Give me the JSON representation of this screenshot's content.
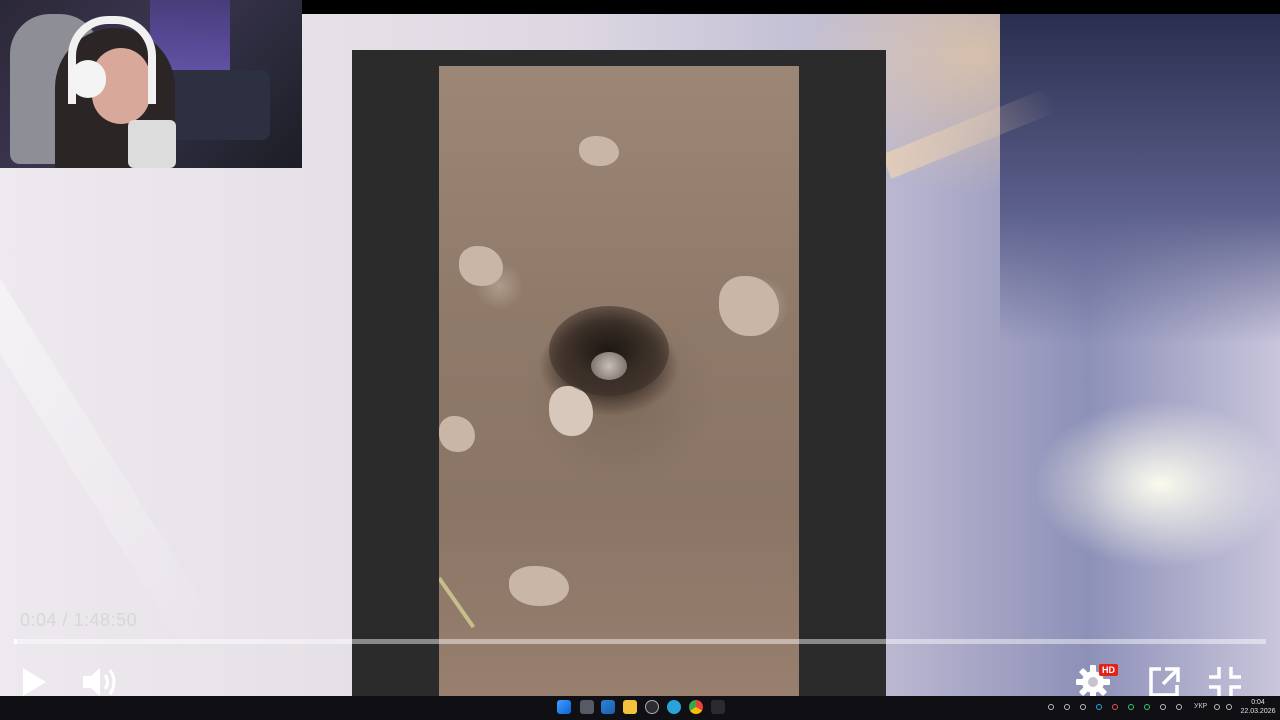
{
  "player": {
    "time_display": "0:04 / 1:48:50",
    "progress_fraction": 0.0006,
    "settings_badge": "HD",
    "accent_color": "#e62117"
  },
  "taskbar": {
    "language": "УКР",
    "clock_time": "0:04",
    "clock_date": "22.03.2026",
    "icons": [
      "windows-start-icon",
      "task-view-icon",
      "widgets-icon",
      "file-explorer-icon",
      "clock-app-icon",
      "telegram-icon",
      "chrome-icon",
      "microphone-icon"
    ]
  }
}
